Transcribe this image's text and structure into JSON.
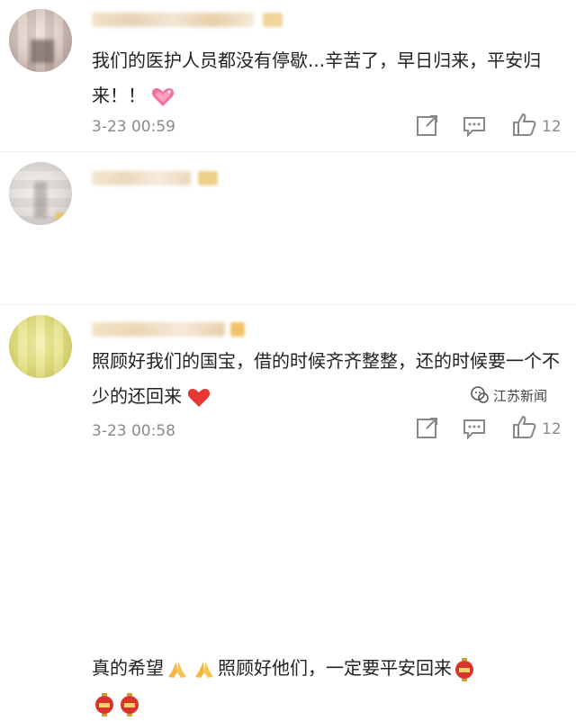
{
  "comments": [
    {
      "text": "我们的医护人员都没有停歇...辛苦了，早日归来，平安归来！！",
      "emoji": "heart-emoji",
      "time": "3-23 00:59",
      "likes": "12"
    },
    {
      "text": "照顾好我们的国宝，借的时候齐齐整整，还的时候要一个不少的还回来",
      "emoji": "red-heart-emoji",
      "time": "3-23 00:58",
      "likes": "12"
    },
    {
      "text_part1": "真的希望",
      "text_part2": "照顾好他们，一定要平安回来",
      "emoji": [
        "praying-hands-emoji",
        "praying-hands-emoji",
        "lantern-emoji",
        "lantern-emoji",
        "lantern-emoji"
      ]
    }
  ],
  "watermark": {
    "label": "江苏新闻"
  },
  "colors": {
    "meta_gray": "#8a8a8a",
    "heart_red": "#e53935",
    "lantern_red": "#d9342b"
  }
}
